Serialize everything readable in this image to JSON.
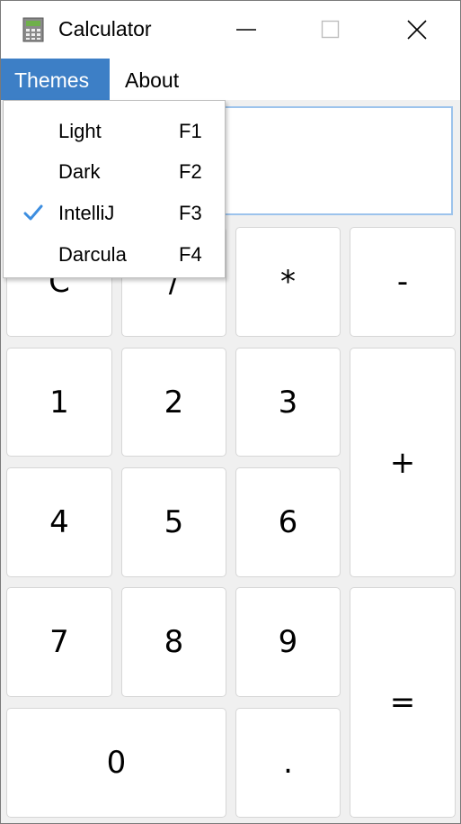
{
  "window": {
    "title": "Calculator",
    "app_icon": "calculator-icon"
  },
  "controls": {
    "minimize_icon": "minimize-icon",
    "maximize_icon": "maximize-icon",
    "close_icon": "close-icon"
  },
  "menubar": {
    "themes": "Themes",
    "about": "About"
  },
  "themes_menu": [
    {
      "label": "Light",
      "shortcut": "F1",
      "checked": false
    },
    {
      "label": "Dark",
      "shortcut": "F2",
      "checked": false
    },
    {
      "label": "IntelliJ",
      "shortcut": "F3",
      "checked": true
    },
    {
      "label": "Darcula",
      "shortcut": "F4",
      "checked": false
    }
  ],
  "display": {
    "value": ""
  },
  "keys": {
    "clear": "C",
    "divide": "/",
    "multiply": "*",
    "minus": "-",
    "one": "1",
    "two": "2",
    "three": "3",
    "plus": "+",
    "four": "4",
    "five": "5",
    "six": "6",
    "seven": "7",
    "eight": "8",
    "nine": "9",
    "equals": "=",
    "zero": "0",
    "dot": "."
  },
  "colors": {
    "menu_selected": "#3d7fc6",
    "check": "#3d8ee0",
    "display_border": "#9cc3ec"
  }
}
